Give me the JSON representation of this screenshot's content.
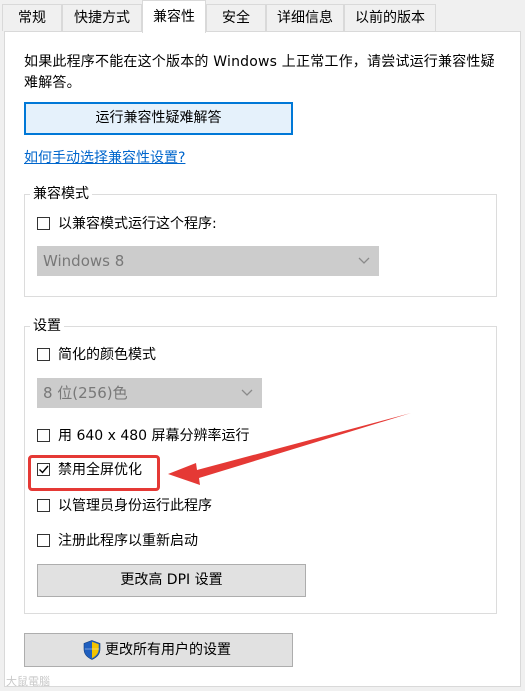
{
  "tabs": [
    {
      "label": "常规"
    },
    {
      "label": "快捷方式"
    },
    {
      "label": "兼容性"
    },
    {
      "label": "安全"
    },
    {
      "label": "详细信息"
    },
    {
      "label": "以前的版本"
    }
  ],
  "active_tab": "兼容性",
  "intro_text": "如果此程序不能在这个版本的 Windows 上正常工作，请尝试运行兼容性疑难解答。",
  "run_troubleshooter_button": "运行兼容性疑难解答",
  "manual_link": "如何手动选择兼容性设置?",
  "compat_mode": {
    "group_title": "兼容模式",
    "checkbox_label": "以兼容模式运行这个程序:",
    "checked": false,
    "os_select_value": "Windows 8"
  },
  "settings": {
    "group_title": "设置",
    "reduced_color": {
      "label": "简化的颜色模式",
      "checked": false
    },
    "color_select_value": "8 位(256)色",
    "low_res": {
      "label": "用 640 x 480 屏幕分辨率运行",
      "checked": false
    },
    "disable_fullscreen_opt": {
      "label": "禁用全屏优化",
      "checked": true
    },
    "run_as_admin": {
      "label": "以管理员身份运行此程序",
      "checked": false
    },
    "register_restart": {
      "label": "注册此程序以重新启动",
      "checked": false
    },
    "high_dpi_button": "更改高 DPI 设置"
  },
  "change_all_users_button": "更改所有用户的设置",
  "watermark": "大鼠電腦",
  "colors": {
    "accent": "#0078d7",
    "highlight": "#e53935",
    "link": "#0066cc"
  }
}
